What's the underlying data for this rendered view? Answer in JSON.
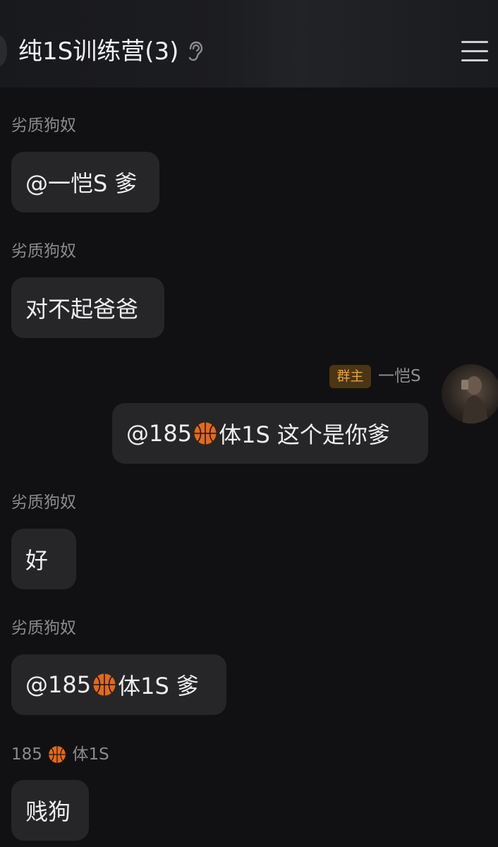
{
  "header": {
    "title": "纯1S训练营(3)",
    "icons": [
      "ear-icon",
      "menu-icon"
    ]
  },
  "messages": [
    {
      "sender": "劣质狗奴",
      "parts": [
        "@一恺S 爹"
      ]
    },
    {
      "sender": "劣质狗奴",
      "parts": [
        "对不起爸爸"
      ]
    },
    {
      "sender": "一恺S",
      "badge": "群主",
      "parts": [
        "@185 ",
        "体1S 这个是你爹"
      ]
    },
    {
      "sender": "劣质狗奴",
      "parts": [
        "好"
      ]
    },
    {
      "sender": "劣质狗奴",
      "parts": [
        "@185 ",
        "体1S 爹"
      ]
    },
    {
      "sender_parts": [
        "185 ",
        "体1S"
      ],
      "parts": [
        "贱狗"
      ]
    }
  ],
  "colors": {
    "background": "#111113",
    "bubble": "#262629",
    "badge_bg": "#4a3614",
    "badge_text": "#e8a23a",
    "sender_text": "#8a8a8e"
  }
}
